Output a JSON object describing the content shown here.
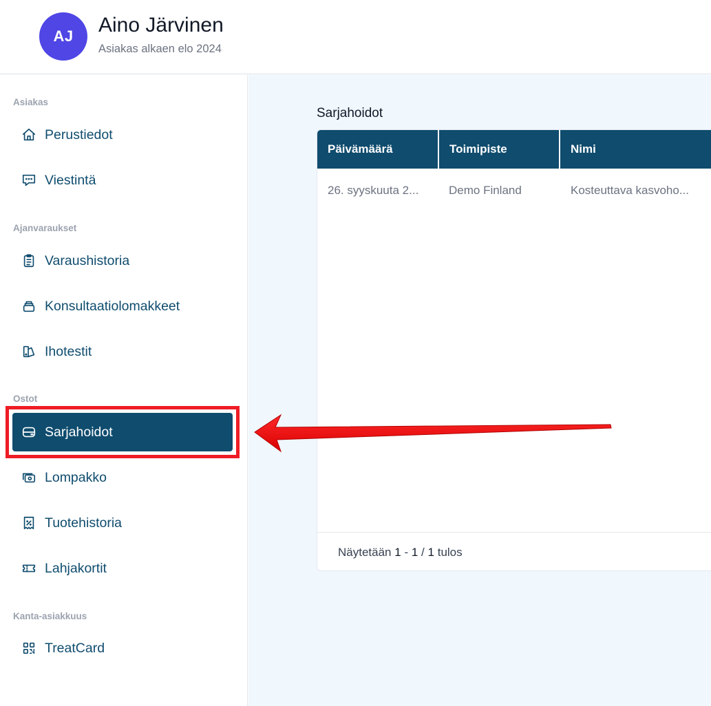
{
  "customer": {
    "initials": "AJ",
    "name": "Aino Järvinen",
    "since": "Asiakas alkaen elo 2024"
  },
  "sidebar": {
    "sections": [
      {
        "title": "Asiakas"
      },
      {
        "title": "Ajanvaraukset"
      },
      {
        "title": "Ostot"
      },
      {
        "title": "Kanta-asiakkuus"
      }
    ],
    "items": [
      {
        "label": "Perustiedot",
        "icon": "home-icon"
      },
      {
        "label": "Viestintä",
        "icon": "message-icon"
      },
      {
        "label": "Varaushistoria",
        "icon": "clipboard-icon"
      },
      {
        "label": "Konsultaatiolomakkeet",
        "icon": "stack-icon"
      },
      {
        "label": "Ihotestit",
        "icon": "palette-icon"
      },
      {
        "label": "Sarjahoidot",
        "icon": "server-icon",
        "active": true
      },
      {
        "label": "Lompakko",
        "icon": "money-icon"
      },
      {
        "label": "Tuotehistoria",
        "icon": "receipt-icon"
      },
      {
        "label": "Lahjakortit",
        "icon": "ticket-icon"
      },
      {
        "label": "TreatCard",
        "icon": "qr-code-icon"
      }
    ]
  },
  "main": {
    "title": "Sarjahoidot",
    "table": {
      "columns": [
        "Päivämäärä",
        "Toimipiste",
        "Nimi"
      ],
      "rows": [
        [
          "26. syyskuuta 2...",
          "Demo Finland",
          "Kosteuttava kasvoho..."
        ]
      ],
      "footer": {
        "prefix": "Näytetään",
        "from": "1",
        "dash": "-",
        "to": "1",
        "slash": "/",
        "total": "1",
        "suffix": "tulos"
      }
    }
  },
  "colors": {
    "primary": "#0f4c6e",
    "avatar": "#4f46e5",
    "annotation": "#ee1c25",
    "background": "#f0f7fd"
  }
}
